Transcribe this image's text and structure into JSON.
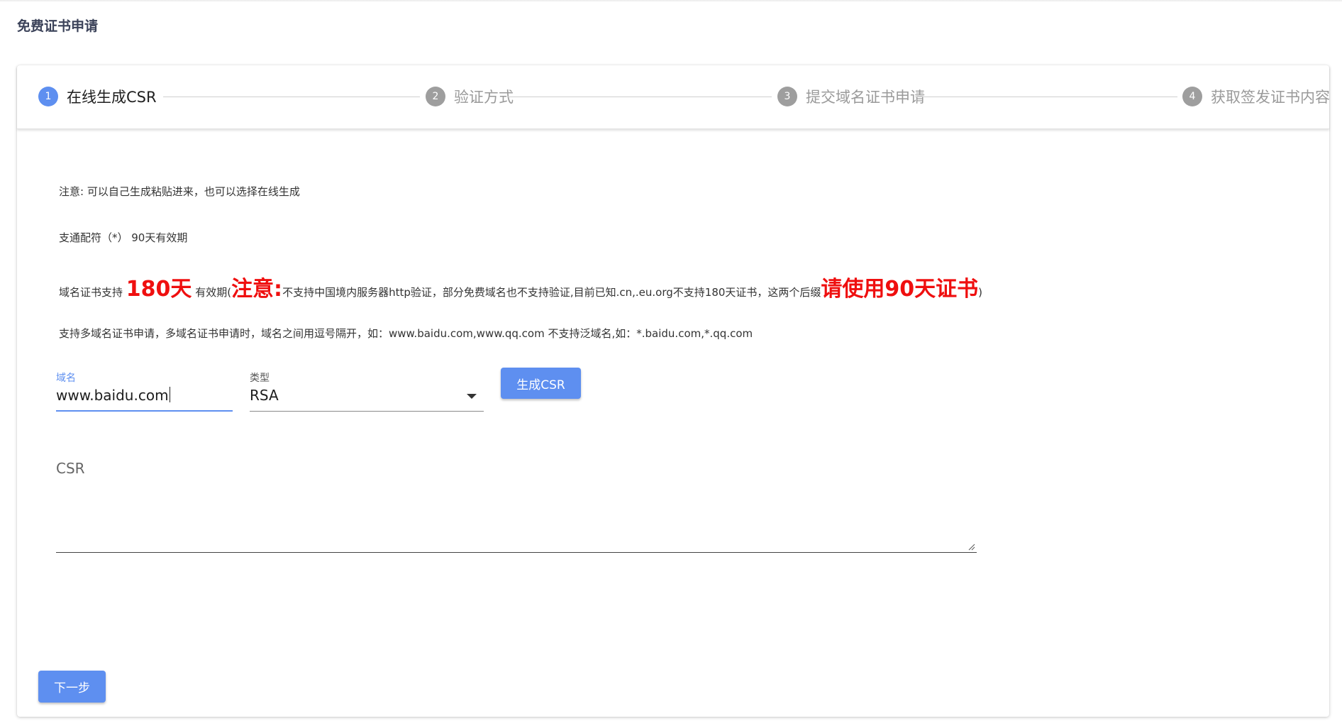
{
  "page": {
    "title": "免费证书申请"
  },
  "stepper": {
    "steps": [
      {
        "number": "1",
        "label": "在线生成CSR"
      },
      {
        "number": "2",
        "label": "验证方式"
      },
      {
        "number": "3",
        "label": "提交域名证书申请"
      },
      {
        "number": "4",
        "label": "获取签发证书内容"
      }
    ],
    "active_step": 1
  },
  "notes": {
    "line1": "注意: 可以自己生成粘贴进来，也可以选择在线生成",
    "line2": "支通配符（*） 90天有效期",
    "line3": {
      "part1": "域名证书支持",
      "big1": "180天",
      "part2": "有效期(",
      "big2": "注意:",
      "part3": "不支持中国境内服务器http验证，部分免费域名也不支持验证,目前已知.cn,.eu.org不支持180天证书，这两个后缀",
      "big3": "请使用90天证书",
      "part4": ")"
    },
    "line4": "支持多域名证书申请，多域名证书申请时，域名之间用逗号隔开，如：www.baidu.com,www.qq.com 不支持泛域名,如：*.baidu.com,*.qq.com"
  },
  "form": {
    "domain_label": "域名",
    "domain_value": "www.baidu.com",
    "type_label": "类型",
    "type_value": "RSA",
    "generate_button": "生成CSR",
    "csr_label": "CSR",
    "csr_value": ""
  },
  "footer": {
    "next_button": "下一步"
  },
  "colors": {
    "accent": "#5e8ff0",
    "warning_red": "#ef0f0f",
    "inactive": "#9e9e9e"
  }
}
